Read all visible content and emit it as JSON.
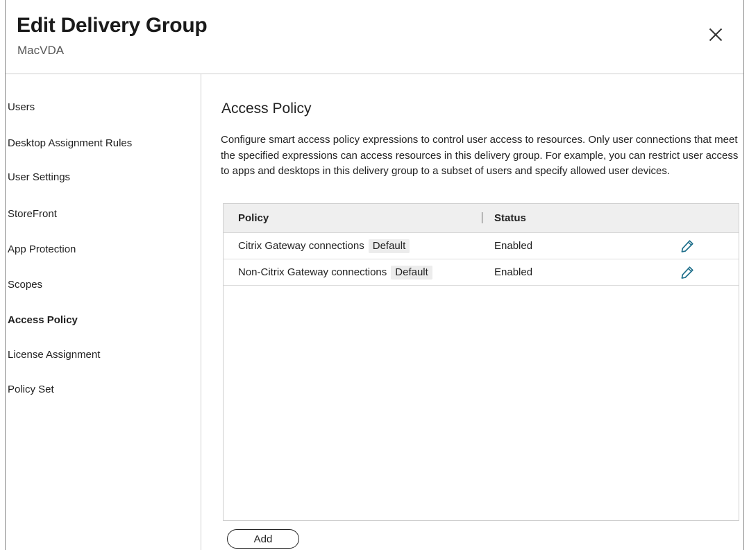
{
  "header": {
    "title": "Edit Delivery Group",
    "subtitle": "MacVDA"
  },
  "sidebar": {
    "items": [
      {
        "label": "Users",
        "active": false
      },
      {
        "label": "Desktop Assignment Rules",
        "active": false
      },
      {
        "label": "User Settings",
        "active": false
      },
      {
        "label": "StoreFront",
        "active": false
      },
      {
        "label": "App Protection",
        "active": false
      },
      {
        "label": "Scopes",
        "active": false
      },
      {
        "label": "Access Policy",
        "active": true
      },
      {
        "label": "License Assignment",
        "active": false
      },
      {
        "label": "Policy Set",
        "active": false
      }
    ]
  },
  "main": {
    "section_title": "Access Policy",
    "description": "Configure smart access policy expressions to control user access to resources. Only user connections that meet the specified expressions can access resources in this delivery group. For example, you can restrict user access to apps and desktops in this delivery group to a subset of users and specify allowed user devices.",
    "table": {
      "columns": [
        "Policy",
        "Status"
      ],
      "rows": [
        {
          "policy": "Citrix Gateway connections",
          "badge": "Default",
          "status": "Enabled"
        },
        {
          "policy": "Non-Citrix Gateway connections",
          "badge": "Default",
          "status": "Enabled"
        }
      ]
    },
    "add_label": "Add"
  },
  "colors": {
    "edit_icon": "#1f6f8b",
    "header_bg": "#efefef",
    "border": "#cfcfcf"
  },
  "icons": {
    "close": "close-icon",
    "edit": "pencil-icon"
  }
}
